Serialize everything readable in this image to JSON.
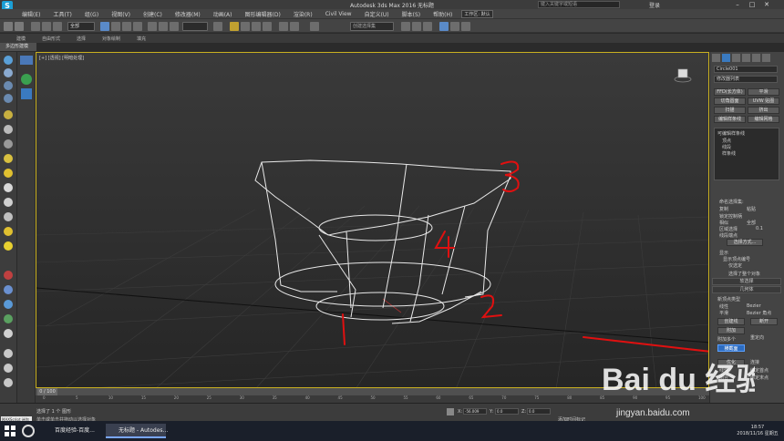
{
  "window": {
    "title": "Autodesk 3ds Max 2016    无标题",
    "search_placeholder": "键入关键字或短语",
    "login": "登录",
    "minimize": "–",
    "maximize": "□",
    "close": "✕"
  },
  "menus": [
    "编辑(E)",
    "工具(T)",
    "组(G)",
    "视图(V)",
    "创建(C)",
    "修改器(M)",
    "动画(A)",
    "图形编辑器(D)",
    "渲染(R)",
    "Civil View",
    "自定义(U)",
    "脚本(S)",
    "帮助(H)"
  ],
  "workspace": "工作区: 默认",
  "toolbar": {
    "selection_filter": "全部",
    "selection_set": "创建选择集"
  },
  "ribbon": {
    "tabs": [
      "建模",
      "自由形式",
      "选择",
      "对象绘制",
      "填充"
    ],
    "sub": "多边形建模"
  },
  "viewport": {
    "label": "[+] [透视] [明暗处理]",
    "annotations": [
      "1",
      "2",
      "3",
      "4"
    ]
  },
  "command_panel": {
    "object_name": "Circle001",
    "modifier_list": "修改器列表",
    "buttons": [
      [
        "FFD(长方体)",
        "平滑"
      ],
      [
        "切角圆面",
        "UVW 贴图"
      ],
      [
        "扫描",
        "挤出"
      ],
      [
        "编辑样条线",
        "编辑网格"
      ]
    ],
    "stack": {
      "root": "可编辑样条线",
      "items": [
        "顶点",
        "线段",
        "样条线"
      ]
    },
    "selection": {
      "named_sel": "命名选择集:",
      "copy": "复制",
      "paste": "粘贴",
      "lock_handles": "锁定控制柄",
      "similar": "相似",
      "all": "全部",
      "area_selection": "区域选择",
      "area_value": "0.1",
      "segment_end": "线段端点",
      "select_by": "选择方式...",
      "display": "显示",
      "show_vertex_numbers": "显示顶点编号",
      "selected_only": "仅选定",
      "selected_count": "选择了整个对象"
    },
    "rollouts": [
      "软选择",
      "几何体"
    ],
    "geometry": {
      "new_vertex_type": "新顶点类型",
      "linear": "线性",
      "bezier": "Bezier",
      "smooth": "平滑",
      "bezier_corner": "Bezier 角点",
      "create_line": "创建线",
      "break": "断开",
      "attach": "附加",
      "attach_multiple": "附加多个",
      "reorient": "重定向",
      "cross_section": "横截面",
      "refine": "优化",
      "connect": "连接",
      "linear_label": "线性",
      "bind_first": "绑定首点",
      "closed": "闭合",
      "bind_last": "绑定末点"
    }
  },
  "timeline": {
    "slider": "0 / 100",
    "ticks": [
      "0",
      "5",
      "10",
      "15",
      "20",
      "25",
      "30",
      "35",
      "40",
      "45",
      "50",
      "55",
      "60",
      "65",
      "70",
      "75",
      "80",
      "85",
      "90",
      "95",
      "100"
    ]
  },
  "status": {
    "maxscript": "MAXScript 迷你",
    "line1": "选择了 1 个 图形",
    "line2": "单击或单击并拖动以选择对象",
    "x_label": "X:",
    "x_value": "-56.009",
    "y_label": "Y:",
    "y_value": "0.0",
    "z_label": "Z:",
    "z_value": "0.0",
    "add_time_tag": "添加时间标记"
  },
  "taskbar": {
    "items": [
      "百度经验-百度...",
      "无标题 - Autodes..."
    ],
    "time": "18:57",
    "date": "2018/11/16 星期五"
  },
  "watermark": {
    "brand": "Bai du 经验",
    "url": "jingyan.baidu.com"
  },
  "colors": {
    "viewport_border": "#c9b020",
    "attach_highlight": "#2d6cc0",
    "annotation_red": "#e01010",
    "wireframe": "#e8e8e8"
  }
}
